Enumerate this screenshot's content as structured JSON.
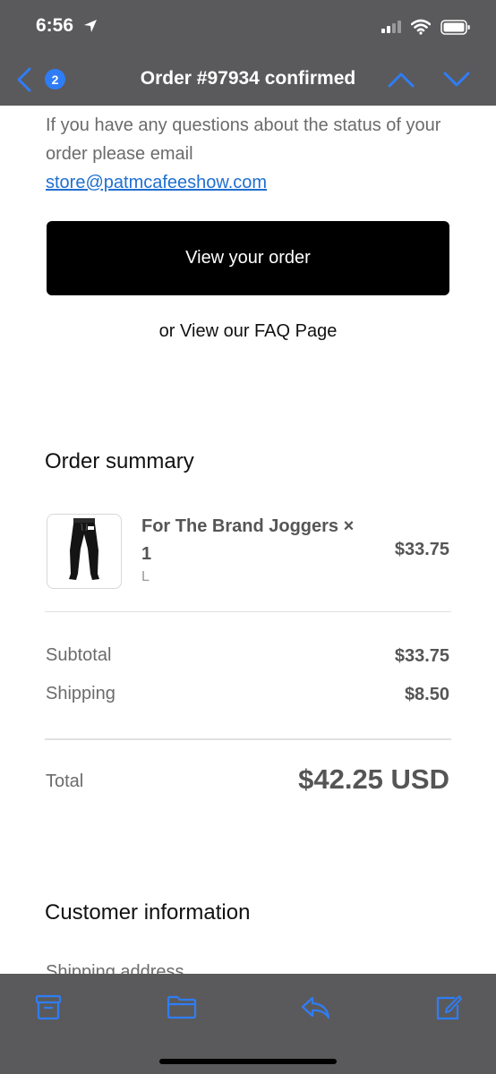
{
  "status_bar": {
    "time": "6:56",
    "icons": [
      "location-arrow-icon",
      "cellular-signal-icon",
      "wifi-icon",
      "battery-icon"
    ]
  },
  "nav": {
    "badge_count": "2",
    "title": "Order #97934 confirmed",
    "icons": [
      "back-chevron-icon",
      "chevron-up-icon",
      "chevron-down-icon"
    ]
  },
  "email": {
    "intro_text": "If you have any questions about the status of your order please email",
    "contact_email": "store@patmcafeeshow.com",
    "view_order_button": "View your order",
    "faq_prefix": "or",
    "faq_link": "View our FAQ Page",
    "order_summary": {
      "title": "Order summary",
      "items": [
        {
          "name": "For The Brand Joggers × 1",
          "variant": "L",
          "price": "$33.75"
        }
      ],
      "subtotal_label": "Subtotal",
      "subtotal_value": "$33.75",
      "shipping_label": "Shipping",
      "shipping_value": "$8.50",
      "total_label": "Total",
      "total_value": "$42.25 USD"
    },
    "customer_info": {
      "title": "Customer information",
      "shipping_address_label": "Shipping address"
    }
  },
  "toolbar": {
    "icons": [
      "archive-icon",
      "folder-icon",
      "reply-icon",
      "compose-icon"
    ]
  },
  "colors": {
    "chrome": "#5a5a5c",
    "accent": "#2f7df6",
    "button": "#000000"
  }
}
